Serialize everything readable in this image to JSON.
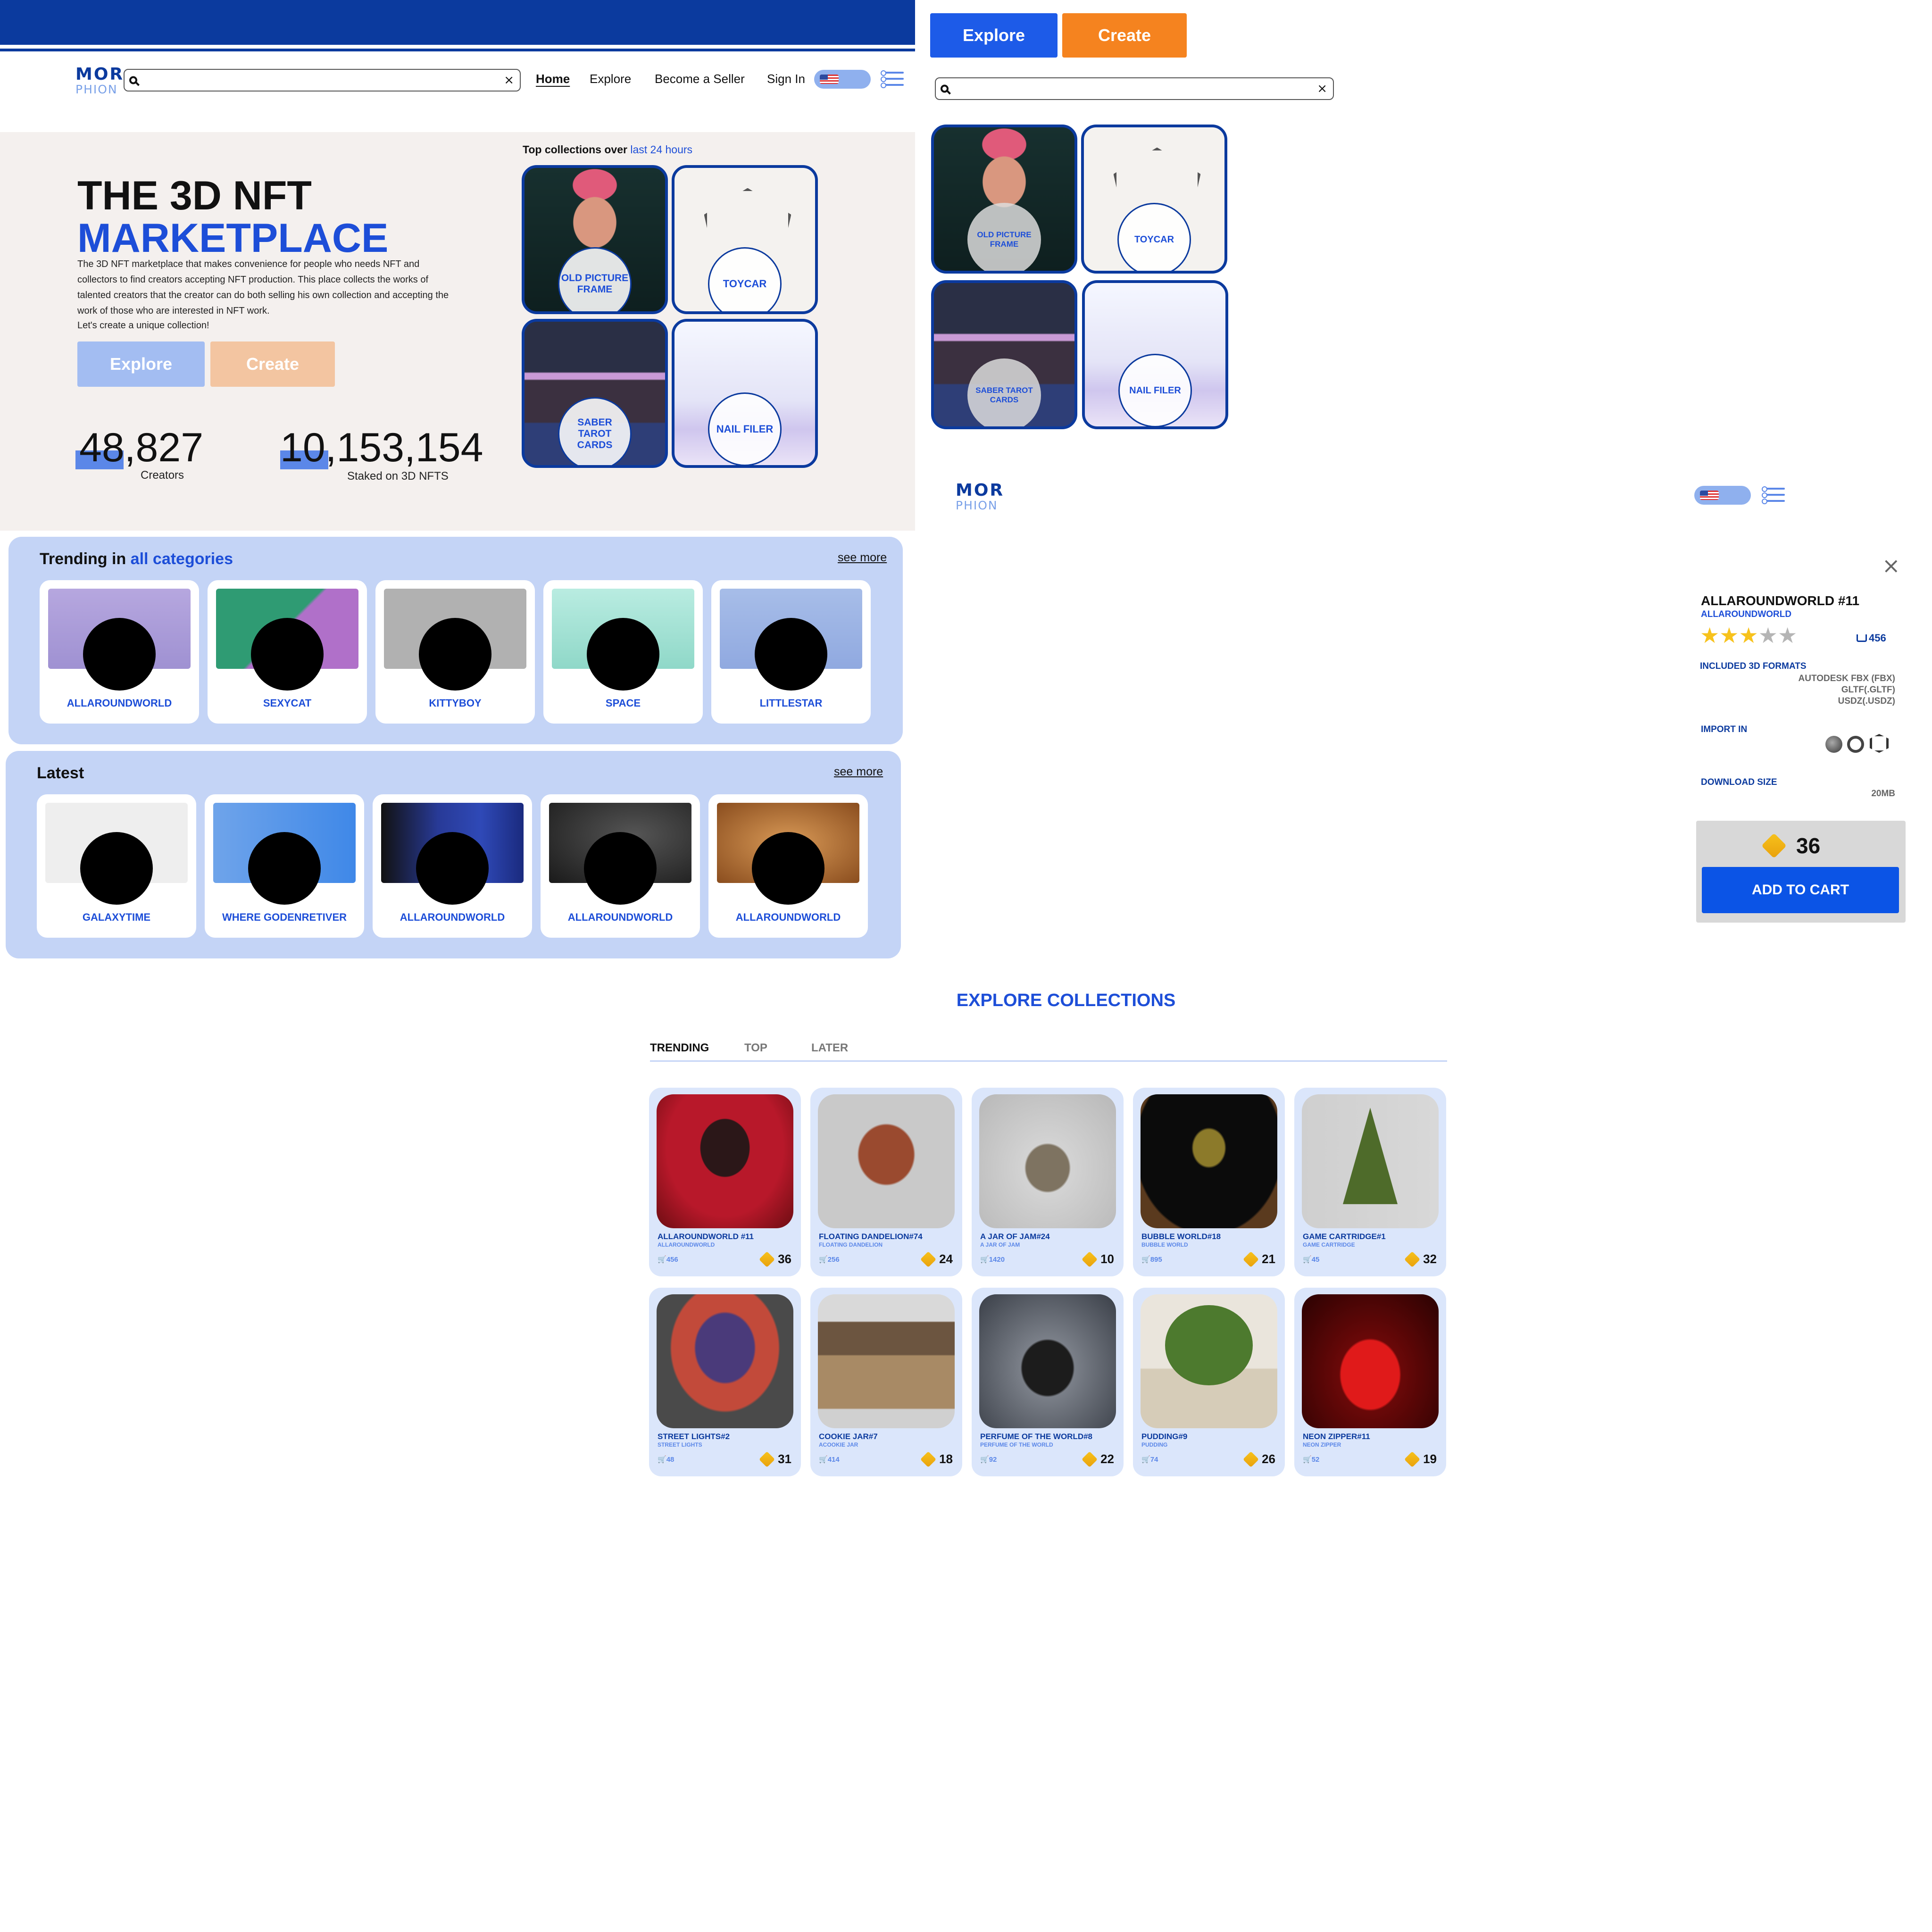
{
  "logo": {
    "line1": "MOR",
    "line2": "PHION"
  },
  "nav": {
    "home": "Home",
    "explore": "Explore",
    "seller": "Become a Seller",
    "signin": "Sign In"
  },
  "hero": {
    "title1": "THE 3D NFT",
    "title2": "MARKETPLACE",
    "description": "The 3D NFT marketplace that makes convenience for people who needs NFT and collectors to find creators accepting NFT production. This place collects the works of talented creators that the creator can do both selling his own collection and accepting the work of those who are interested in NFT work.",
    "tagline": "Let's create a unique collection!",
    "explore_btn": "Explore",
    "create_btn": "Create",
    "stat1_value": "48,827",
    "stat1_label": "Creators",
    "stat2_value": "10,153,154",
    "stat2_label": "Staked on 3D NFTS"
  },
  "top_collections": {
    "heading": "Top collections over",
    "heading_hl": "last 24 hours",
    "items": [
      "OLD PICTURE FRAME",
      "TOYCAR",
      "SABER TAROT CARDS",
      "NAIL FILER"
    ]
  },
  "trending": {
    "title": "Trending in",
    "title_hl": "all categories",
    "see_more": "see more",
    "items": [
      "ALLAROUNDWORLD",
      "SEXYCAT",
      "KITTYBOY",
      "SPACE",
      "LITTLESTAR"
    ]
  },
  "latest": {
    "title": "Latest",
    "see_more": "see more",
    "items": [
      "GALAXYTIME",
      "WHERE GODENRETIVER",
      "ALLAROUNDWORLD",
      "ALLAROUNDWORLD",
      "ALLAROUNDWORLD"
    ]
  },
  "right": {
    "explore_btn": "Explore",
    "create_btn": "Create",
    "tiles": [
      "OLD PICTURE FRAME",
      "TOYCAR",
      "SABER TAROT CARDS",
      "NAIL FILER"
    ]
  },
  "detail": {
    "title": "ALLAROUNDWORLD #11",
    "subtitle": "ALLAROUNDWORLD",
    "rating": 3,
    "rating_max": 5,
    "cart_count": "456",
    "formats_label": "INCLUDED 3D FORMATS",
    "formats": [
      "AUTODESK FBX (FBX)",
      "GLTF(.GLTF)",
      "USDZ(.USDZ)"
    ],
    "import_label": "IMPORT IN",
    "import_icons": [
      "cinema4d-icon",
      "blender-icon",
      "unity-icon"
    ],
    "download_label": "DOWNLOAD SIZE",
    "download_size": "20MB",
    "price": "36",
    "add_to_cart": "ADD TO CART"
  },
  "explore": {
    "title": "EXPLORE COLLECTIONS",
    "tabs": [
      "TRENDING",
      "TOP",
      "LATER"
    ],
    "items": [
      {
        "name": "ALLAROUNDWORLD #11",
        "sub": "ALLAROUNDWORLD",
        "count": "456",
        "price": "36"
      },
      {
        "name": "FLOATING DANDELION#74",
        "sub": "FLOATING DANDELION",
        "count": "256",
        "price": "24"
      },
      {
        "name": "A JAR OF JAM#24",
        "sub": "A JAR OF JAM",
        "count": "1420",
        "price": "10"
      },
      {
        "name": "BUBBLE WORLD#18",
        "sub": "BUBBLE WORLD",
        "count": "895",
        "price": "21"
      },
      {
        "name": "GAME CARTRIDGE#1",
        "sub": "GAME CARTRIDGE",
        "count": "45",
        "price": "32"
      },
      {
        "name": "STREET LIGHTS#2",
        "sub": "STREET LIGHTS",
        "count": "48",
        "price": "31"
      },
      {
        "name": "COOKIE JAR#7",
        "sub": "ACOOKIE JAR",
        "count": "414",
        "price": "18"
      },
      {
        "name": "PERFUME OF THE WORLD#8",
        "sub": "PERFUME OF THE WORLD",
        "count": "92",
        "price": "22"
      },
      {
        "name": "PUDDING#9",
        "sub": "PUDDING",
        "count": "74",
        "price": "26"
      },
      {
        "name": "NEON ZIPPER#11",
        "sub": "NEON ZIPPER",
        "count": "52",
        "price": "19"
      }
    ]
  },
  "colors": {
    "brand_dark": "#0b3a9e",
    "brand": "#1d4ed8",
    "accent_orange": "#f5831f",
    "panel": "#c4d4f6",
    "coin": "#f7c21c"
  }
}
